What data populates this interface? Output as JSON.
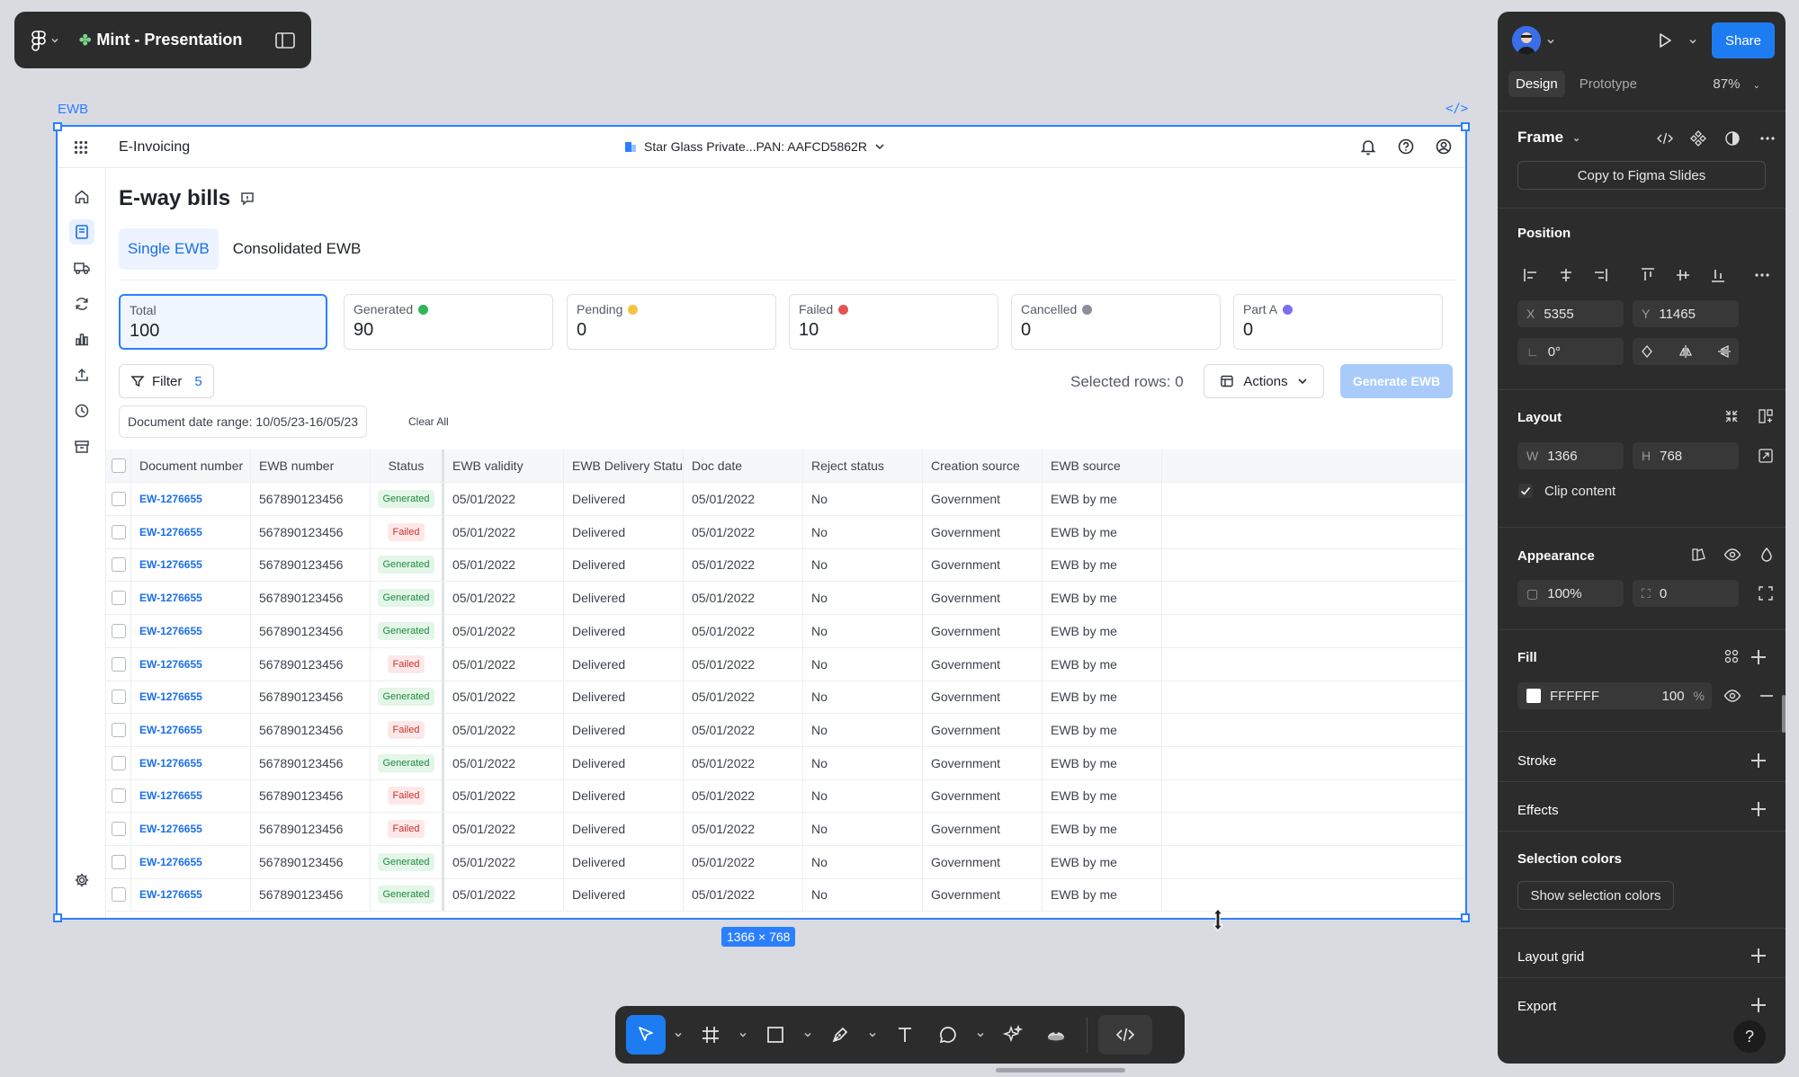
{
  "figma": {
    "file_name": "Mint - Presentation",
    "frame_label": "EWB",
    "code_label": "</>",
    "dimensions_tag": "1366 × 768"
  },
  "app": {
    "name": "E-Invoicing",
    "org": "Star Glass Private...PAN: AAFCD5862R",
    "page_title": "E-way bills",
    "tabs": [
      {
        "label": "Single EWB",
        "active": true
      },
      {
        "label": "Consolidated EWB",
        "active": false
      }
    ],
    "stats": [
      {
        "label": "Total",
        "value": "100",
        "dot": ""
      },
      {
        "label": "Generated",
        "value": "90",
        "dot": "#2fb55a"
      },
      {
        "label": "Pending",
        "value": "0",
        "dot": "#f4c542"
      },
      {
        "label": "Failed",
        "value": "10",
        "dot": "#e25555"
      },
      {
        "label": "Cancelled",
        "value": "0",
        "dot": "#8a8f98"
      },
      {
        "label": "Part A",
        "value": "0",
        "dot": "#7b6ef0"
      }
    ],
    "filter": {
      "label": "Filter",
      "count": "5"
    },
    "selected_rows": "Selected rows: 0",
    "actions_label": "Actions",
    "generate_label": "Generate EWB",
    "date_range": "Document date range: 10/05/23-16/05/23",
    "clear_all": "Clear All",
    "columns": [
      "Document number",
      "EWB number",
      "Status",
      "EWB validity",
      "EWB Delivery Status",
      "Doc date",
      "Reject status",
      "Creation source",
      "EWB source"
    ],
    "rows": [
      {
        "doc": "EW-1276655",
        "ewb": "567890123456",
        "status": "Generated",
        "validity": "05/01/2022",
        "delivery": "Delivered",
        "date": "05/01/2022",
        "reject": "No",
        "creation": "Government",
        "source": "EWB by me"
      },
      {
        "doc": "EW-1276655",
        "ewb": "567890123456",
        "status": "Failed",
        "validity": "05/01/2022",
        "delivery": "Delivered",
        "date": "05/01/2022",
        "reject": "No",
        "creation": "Government",
        "source": "EWB by me"
      },
      {
        "doc": "EW-1276655",
        "ewb": "567890123456",
        "status": "Generated",
        "validity": "05/01/2022",
        "delivery": "Delivered",
        "date": "05/01/2022",
        "reject": "No",
        "creation": "Government",
        "source": "EWB by me"
      },
      {
        "doc": "EW-1276655",
        "ewb": "567890123456",
        "status": "Generated",
        "validity": "05/01/2022",
        "delivery": "Delivered",
        "date": "05/01/2022",
        "reject": "No",
        "creation": "Government",
        "source": "EWB by me"
      },
      {
        "doc": "EW-1276655",
        "ewb": "567890123456",
        "status": "Generated",
        "validity": "05/01/2022",
        "delivery": "Delivered",
        "date": "05/01/2022",
        "reject": "No",
        "creation": "Government",
        "source": "EWB by me"
      },
      {
        "doc": "EW-1276655",
        "ewb": "567890123456",
        "status": "Failed",
        "validity": "05/01/2022",
        "delivery": "Delivered",
        "date": "05/01/2022",
        "reject": "No",
        "creation": "Government",
        "source": "EWB by me"
      },
      {
        "doc": "EW-1276655",
        "ewb": "567890123456",
        "status": "Generated",
        "validity": "05/01/2022",
        "delivery": "Delivered",
        "date": "05/01/2022",
        "reject": "No",
        "creation": "Government",
        "source": "EWB by me"
      },
      {
        "doc": "EW-1276655",
        "ewb": "567890123456",
        "status": "Failed",
        "validity": "05/01/2022",
        "delivery": "Delivered",
        "date": "05/01/2022",
        "reject": "No",
        "creation": "Government",
        "source": "EWB by me"
      },
      {
        "doc": "EW-1276655",
        "ewb": "567890123456",
        "status": "Generated",
        "validity": "05/01/2022",
        "delivery": "Delivered",
        "date": "05/01/2022",
        "reject": "No",
        "creation": "Government",
        "source": "EWB by me"
      },
      {
        "doc": "EW-1276655",
        "ewb": "567890123456",
        "status": "Failed",
        "validity": "05/01/2022",
        "delivery": "Delivered",
        "date": "05/01/2022",
        "reject": "No",
        "creation": "Government",
        "source": "EWB by me"
      },
      {
        "doc": "EW-1276655",
        "ewb": "567890123456",
        "status": "Failed",
        "validity": "05/01/2022",
        "delivery": "Delivered",
        "date": "05/01/2022",
        "reject": "No",
        "creation": "Government",
        "source": "EWB by me"
      },
      {
        "doc": "EW-1276655",
        "ewb": "567890123456",
        "status": "Generated",
        "validity": "05/01/2022",
        "delivery": "Delivered",
        "date": "05/01/2022",
        "reject": "No",
        "creation": "Government",
        "source": "EWB by me"
      },
      {
        "doc": "EW-1276655",
        "ewb": "567890123456",
        "status": "Generated",
        "validity": "05/01/2022",
        "delivery": "Delivered",
        "date": "05/01/2022",
        "reject": "No",
        "creation": "Government",
        "source": "EWB by me"
      }
    ]
  },
  "panel": {
    "share": "Share",
    "tabs": [
      "Design",
      "Prototype"
    ],
    "zoom": "87%",
    "frame_type": "Frame",
    "copy_slides": "Copy to Figma Slides",
    "position": {
      "title": "Position",
      "x_label": "X",
      "x": "5355",
      "y_label": "Y",
      "y": "11465",
      "rotation": "0°"
    },
    "layout": {
      "title": "Layout",
      "w_label": "W",
      "w": "1366",
      "h_label": "H",
      "h": "768",
      "clip": "Clip content"
    },
    "appearance": {
      "title": "Appearance",
      "opacity": "100%",
      "radius": "0"
    },
    "fill": {
      "title": "Fill",
      "hex": "FFFFFF",
      "opacity": "100",
      "unit": "%"
    },
    "stroke": "Stroke",
    "effects": "Effects",
    "selection_colors": {
      "title": "Selection colors",
      "button": "Show selection colors"
    },
    "layout_grid": "Layout grid",
    "export": "Export",
    "help": "?"
  },
  "colors": {
    "accent": "#2b7fff",
    "figma_dark": "#2c2c2c",
    "share_blue": "#1e7cf2"
  }
}
